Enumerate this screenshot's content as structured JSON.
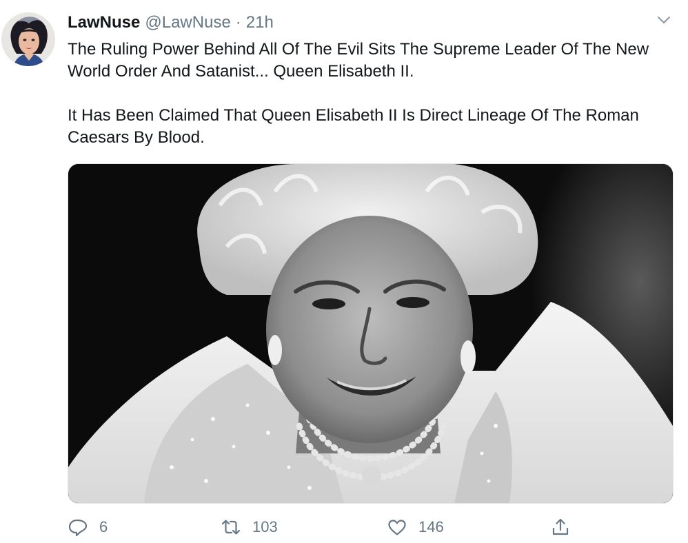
{
  "tweet": {
    "author": {
      "display_name": "LawNuse",
      "handle": "@LawNuse",
      "avatar_icon": "woman-portrait-avatar"
    },
    "separator": "·",
    "timestamp": "21h",
    "menu_icon": "chevron-down-icon",
    "paragraphs": [
      "The Ruling Power Behind All Of The Evil Sits The Supreme Leader Of The New World Order And Satanist... Queen Elisabeth II.",
      "It Has Been Claimed That Queen Elisabeth II Is Direct Lineage Of The Roman Caesars By Blood."
    ],
    "media": {
      "type": "black-and-white photo",
      "subject_icon": "portrait-photo"
    },
    "actions": {
      "reply": {
        "icon": "reply-icon",
        "count": "6"
      },
      "retweet": {
        "icon": "retweet-icon",
        "count": "103"
      },
      "like": {
        "icon": "heart-icon",
        "count": "146"
      },
      "share": {
        "icon": "share-icon"
      }
    }
  },
  "colors": {
    "text": "#14171a",
    "muted": "#657786",
    "border": "#e1e8ed",
    "background": "#ffffff"
  }
}
